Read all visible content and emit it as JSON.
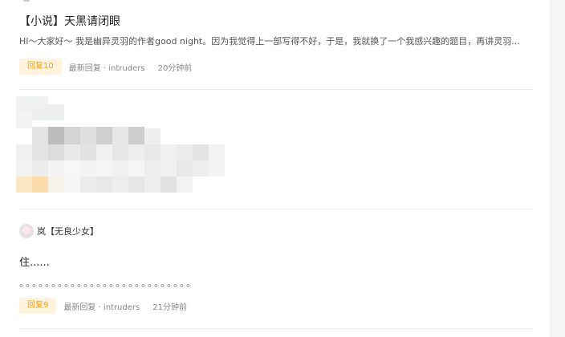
{
  "posts": [
    {
      "title": "【小说】天黑请闭眼",
      "excerpt": "HI～大家好～ 我是幽异灵羽的作者good night。因为我觉得上一部写得不好，于是，我就换了一个我感兴趣的题目，再讲灵羽...",
      "reply_label": "回复10",
      "latest_reply": "最新回复 · intruders",
      "time": "20分钟前"
    },
    {
      "author": "岚【无良少女】",
      "body": "住......",
      "dots": "。。。。。。。。。。。。。。。。。。。。。。。。。。。",
      "reply_label": "回复9",
      "latest_reply": "最新回复 · intruders",
      "time": "21分钟前"
    }
  ],
  "colors": {
    "reply_badge_bg": "#fff3dd",
    "reply_badge_text": "#f0a020",
    "divider": "#ececec"
  }
}
